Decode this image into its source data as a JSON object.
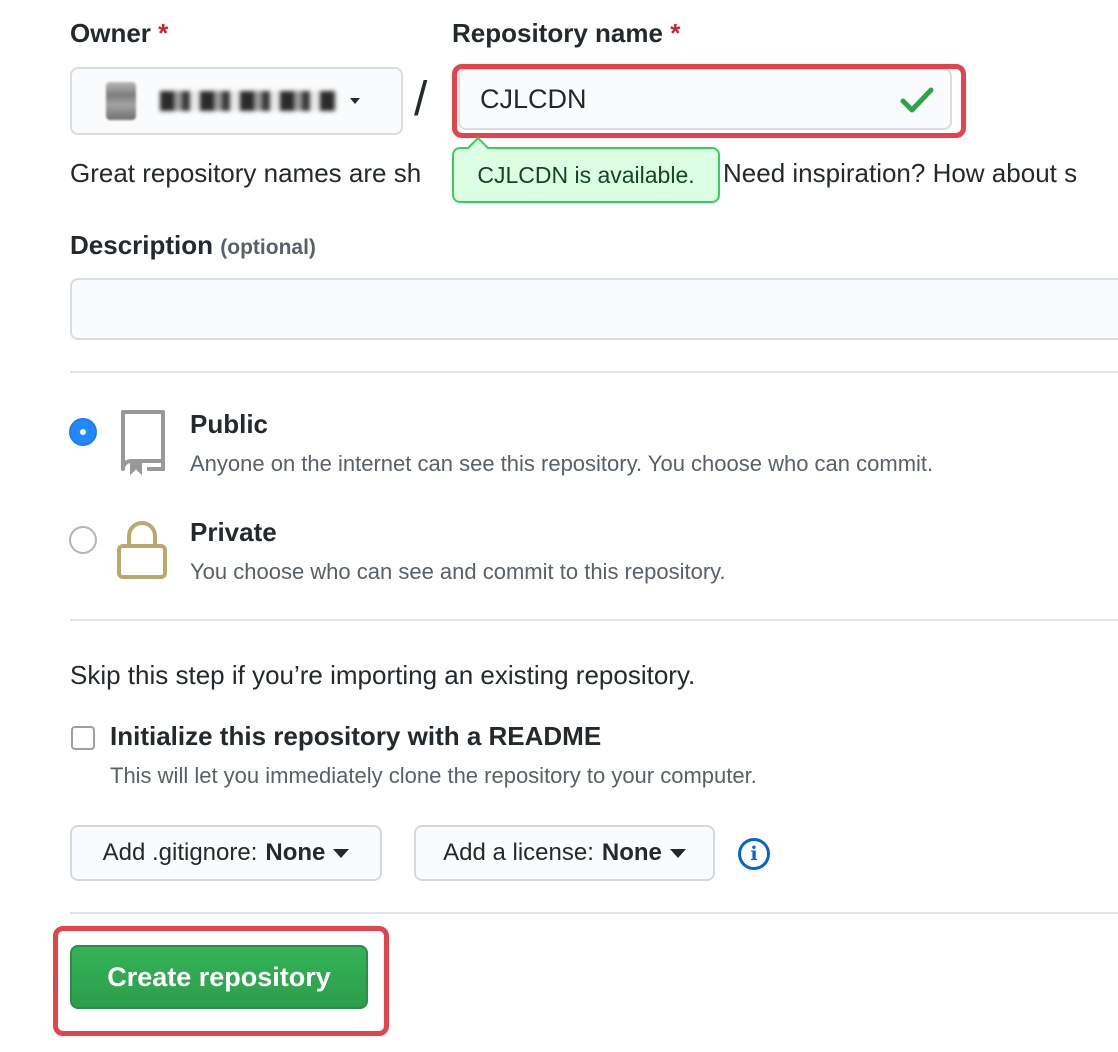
{
  "owner": {
    "label": "Owner",
    "required_mark": "*"
  },
  "repository_name": {
    "label": "Repository name",
    "required_mark": "*",
    "value": "CJLCDN",
    "separator": "/",
    "tooltip": "CJLCDN is available.",
    "hint_before": "Great repository names are sh",
    "hint_after": "Need inspiration? How about s"
  },
  "description": {
    "label": "Description",
    "optional": "(optional)",
    "value": ""
  },
  "visibility": {
    "public": {
      "title": "Public",
      "desc": "Anyone on the internet can see this repository. You choose who can commit.",
      "selected": true
    },
    "private": {
      "title": "Private",
      "desc": "You choose who can see and commit to this repository.",
      "selected": false
    }
  },
  "init": {
    "skip_note": "Skip this step if you’re importing an existing repository.",
    "readme_label": "Initialize this repository with a README",
    "readme_desc": "This will let you immediately clone the repository to your computer.",
    "readme_checked": false
  },
  "gitignore": {
    "prefix": "Add .gitignore:",
    "value": "None"
  },
  "license": {
    "prefix": "Add a license:",
    "value": "None"
  },
  "info_icon": "i",
  "create_button": "Create repository",
  "colors": {
    "accent_blue": "#2188ff",
    "success_green": "#2ea44f",
    "check_green": "#28a745",
    "tooltip_bg": "#dcffe4",
    "highlight_red": "#e5434b",
    "required_red": "#cb2431"
  }
}
